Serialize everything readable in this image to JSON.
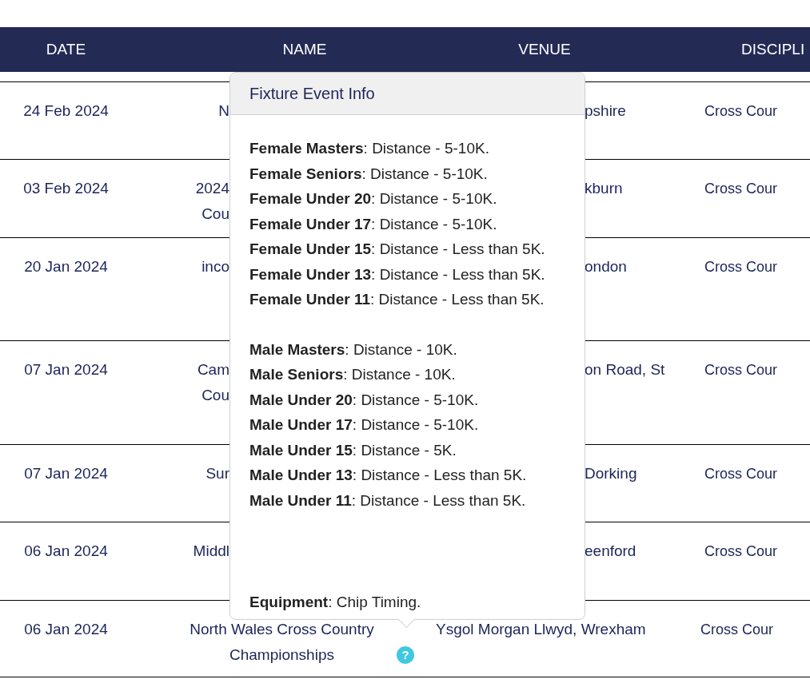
{
  "table": {
    "columns": [
      "DATE",
      "NAME",
      "VENUE",
      "DISCIPLI"
    ],
    "rows": [
      {
        "clipped": true,
        "date": "24 Feb 2024",
        "name": [
          "N"
        ],
        "venue": "pshire",
        "discipline": "Cross Cour"
      },
      {
        "clipped": true,
        "date": "03 Feb 2024",
        "name": [
          "2024",
          "Cou"
        ],
        "venue": "kburn",
        "discipline": "Cross Cour"
      },
      {
        "clipped": true,
        "date": "20 Jan 2024",
        "name": [
          "inco"
        ],
        "venue": "ondon",
        "discipline": "Cross Cour"
      },
      {
        "clipped": true,
        "date": "07 Jan 2024",
        "name": [
          "Cam",
          "Cou"
        ],
        "venue": "on Road, St",
        "discipline": "Cross Cour"
      },
      {
        "clipped": true,
        "date": "07 Jan 2024",
        "name": [
          "Sur"
        ],
        "venue": "Dorking",
        "discipline": "Cross Cour"
      },
      {
        "clipped": true,
        "date": "06 Jan 2024",
        "name": [
          "Middl"
        ],
        "venue": "eenford",
        "discipline": "Cross Cour"
      },
      {
        "clipped": false,
        "date": "06 Jan 2024",
        "name": [
          "North Wales Cross Country",
          "Championships"
        ],
        "help": "?",
        "venue": "Ysgol Morgan Llwyd, Wrexham",
        "discipline": "Cross Cour"
      }
    ]
  },
  "popover": {
    "title": "Fixture Event Info",
    "sections": [
      [
        "**Female Masters**: Distance - 5-10K.",
        "**Female Seniors**: Distance - 5-10K.",
        "**Female Under 20**: Distance - 5-10K.",
        "**Female Under 17**: Distance - 5-10K.",
        "**Female Under 15**: Distance - Less than 5K.",
        "**Female Under 13**: Distance - Less than 5K.",
        "**Female Under 11**: Distance - Less than 5K."
      ],
      [
        "**Male Masters**: Distance - 10K.",
        "**Male Seniors**: Distance - 10K.",
        "**Male Under 20**: Distance - 5-10K.",
        "**Male Under 17**: Distance - 5-10K.",
        "**Male Under 15**: Distance - 5K.",
        "**Male Under 13**: Distance - Less than 5K.",
        "**Male Under 11**: Distance - Less than 5K."
      ],
      [
        "**Equipment**: Chip Timing."
      ]
    ]
  }
}
